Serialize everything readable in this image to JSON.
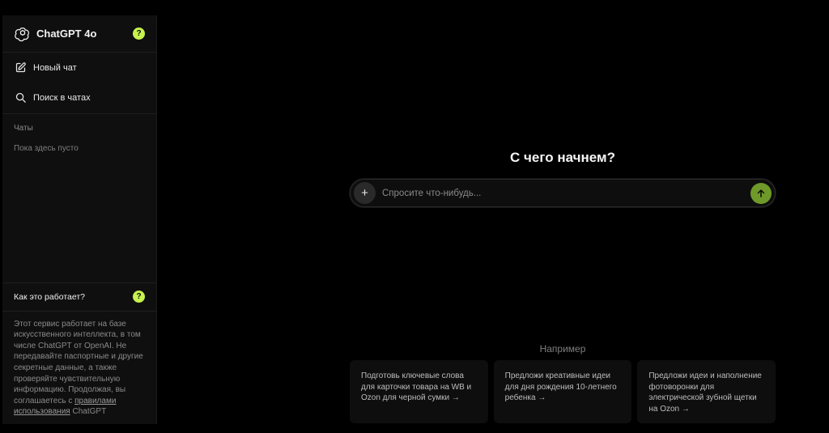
{
  "sidebar": {
    "title": "ChatGPT 4o",
    "help_symbol": "?",
    "nav": [
      {
        "label": "Новый чат",
        "icon": "edit-icon"
      },
      {
        "label": "Поиск в чатах",
        "icon": "search-icon"
      }
    ],
    "chats_heading": "Чаты",
    "chats_empty": "Пока здесь пусто",
    "how_it_works": "Как это работает?",
    "disclaimer_text": "Этот сервис работает на базе искусственного интеллекта, в том числе ChatGPT от OpenAI. Не передавайте паспортные и другие секретные данные, а также проверяйте чувствительную информацию. Продолжая, вы соглашаетесь с ",
    "disclaimer_link": "правилами использования",
    "disclaimer_suffix": " ChatGPT"
  },
  "main": {
    "heading": "С чего начнем?",
    "prompt_placeholder": "Спросите что-нибудь...",
    "plus_symbol": "+",
    "examples_title": "Например",
    "examples": [
      "Подготовь ключевые слова для карточки товара на WB и Ozon для черной сумки →",
      "Предложи креативные идеи для дня рождения 10-летнего ребенка →",
      "Предложи идеи и наполнение фотоворонки для электрической зубной щетки на Ozon →"
    ]
  },
  "colors": {
    "accent_badge": "#c6f24e",
    "send_button": "#6f9a2a",
    "background": "#000000",
    "sidebar_bg": "#0f0f0f"
  }
}
